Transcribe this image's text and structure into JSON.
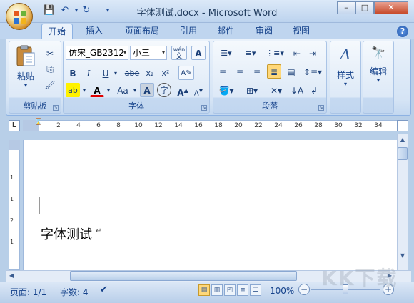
{
  "window": {
    "title": "字体测试.docx - Microsoft Word",
    "min_label": "–",
    "max_label": "□",
    "close_label": "✕"
  },
  "tabs": [
    {
      "label": "开始",
      "active": true
    },
    {
      "label": "插入"
    },
    {
      "label": "页面布局"
    },
    {
      "label": "引用"
    },
    {
      "label": "邮件"
    },
    {
      "label": "审阅"
    },
    {
      "label": "视图"
    }
  ],
  "ribbon": {
    "clipboard": {
      "label": "剪贴板",
      "paste_label": "粘贴"
    },
    "font": {
      "label": "字体",
      "font_name": "仿宋_GB2312",
      "font_size": "小三",
      "bold": "B",
      "italic": "I",
      "underline": "U",
      "strike": "abe",
      "subscript": "x₂",
      "superscript": "x²",
      "grow": "A",
      "shrink": "A",
      "case": "Aa",
      "phonetic": "wén",
      "phonetic_char": "文"
    },
    "paragraph": {
      "label": "段落"
    },
    "styles": {
      "label": "样式"
    },
    "editing": {
      "label": "编辑"
    }
  },
  "ruler": {
    "ticks": [
      "2",
      "4",
      "6",
      "8",
      "10",
      "12",
      "14",
      "16",
      "18",
      "20",
      "22",
      "24",
      "26",
      "28",
      "30",
      "32",
      "34"
    ],
    "vticks": [
      "1",
      "1",
      "2",
      "1"
    ]
  },
  "document": {
    "text": "字体测试",
    "para_mark": "↵"
  },
  "status": {
    "page": "页面: 1/1",
    "words": "字数: 4",
    "zoom": "100%",
    "zoom_minus": "−",
    "zoom_plus": "+",
    "zoom_level": 0.5
  },
  "watermark": "KK下载"
}
